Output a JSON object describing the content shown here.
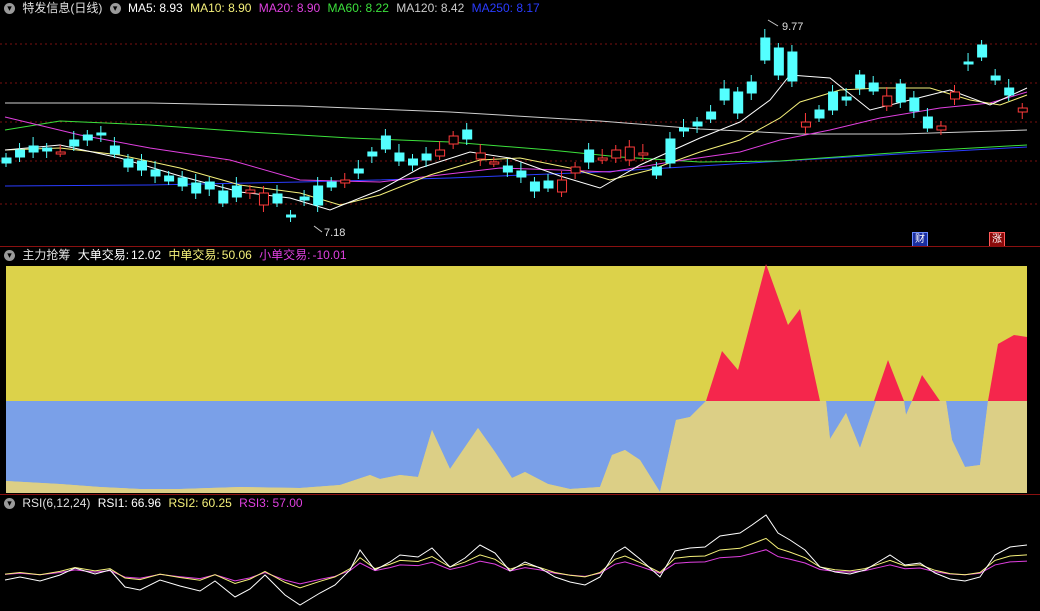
{
  "main": {
    "title": "特发信息(日线)",
    "ma": [
      {
        "label": "MA5: 8.93",
        "color": "#ffffff"
      },
      {
        "label": "MA10: 8.90",
        "color": "#f5f07a"
      },
      {
        "label": "MA20: 8.90",
        "color": "#e040e0"
      },
      {
        "label": "MA60: 8.22",
        "color": "#3ce13c"
      },
      {
        "label": "MA120: 8.42",
        "color": "#cccccc"
      },
      {
        "label": "MA250: 8.17",
        "color": "#2a3cff"
      }
    ],
    "high_label": "9.77",
    "low_label": "7.18",
    "badge_cai": "财",
    "badge_zhang": "涨"
  },
  "flow": {
    "title": "主力抢筹",
    "big_label": "大单交易:",
    "big_value": "12.02",
    "mid_label": "中单交易:",
    "mid_value": "50.06",
    "small_label": "小单交易:",
    "small_value": "-10.01",
    "colors": {
      "big": "#ffffff",
      "mid": "#f5f07a",
      "small": "#e040e0"
    }
  },
  "rsi": {
    "title": "RSI(6,12,24)",
    "rsi1": "RSI1: 66.96",
    "rsi2": "RSI2: 60.25",
    "rsi3": "RSI3: 57.00"
  }
}
